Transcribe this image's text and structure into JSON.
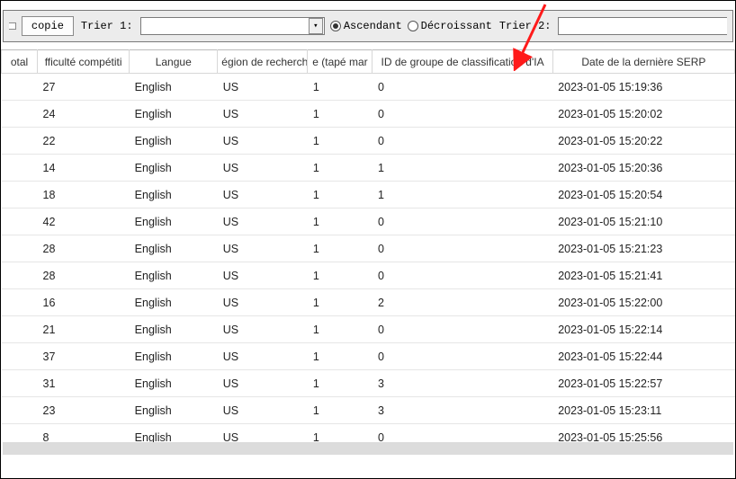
{
  "toolbar": {
    "copie_label": "copie",
    "trier1_label": "Trier 1:",
    "trier2_label": "Trier 2:",
    "trier1_value": "",
    "trier2_value": "",
    "ascendant_label": "Ascendant",
    "descroissant_label": "Décroissant",
    "sort_direction": "ascendant"
  },
  "columns": {
    "total": "otal",
    "difficulte": "fficulté compétiti",
    "langue": "Langue",
    "region": "égion de recherch",
    "tape": "e (tapé mar",
    "ai_group": "ID de groupe de classification d'IA",
    "date": "Date de la dernière SERP"
  },
  "rows": [
    {
      "total": "",
      "diff": "27",
      "lang": "English",
      "reg": "US",
      "tape": "1",
      "ai": "0",
      "date": "2023-01-05 15:19:36"
    },
    {
      "total": "",
      "diff": "24",
      "lang": "English",
      "reg": "US",
      "tape": "1",
      "ai": "0",
      "date": "2023-01-05 15:20:02"
    },
    {
      "total": "",
      "diff": "22",
      "lang": "English",
      "reg": "US",
      "tape": "1",
      "ai": "0",
      "date": "2023-01-05 15:20:22"
    },
    {
      "total": "",
      "diff": "14",
      "lang": "English",
      "reg": "US",
      "tape": "1",
      "ai": "1",
      "date": "2023-01-05 15:20:36"
    },
    {
      "total": "",
      "diff": "18",
      "lang": "English",
      "reg": "US",
      "tape": "1",
      "ai": "1",
      "date": "2023-01-05 15:20:54"
    },
    {
      "total": "",
      "diff": "42",
      "lang": "English",
      "reg": "US",
      "tape": "1",
      "ai": "0",
      "date": "2023-01-05 15:21:10"
    },
    {
      "total": "",
      "diff": "28",
      "lang": "English",
      "reg": "US",
      "tape": "1",
      "ai": "0",
      "date": "2023-01-05 15:21:23"
    },
    {
      "total": "",
      "diff": "28",
      "lang": "English",
      "reg": "US",
      "tape": "1",
      "ai": "0",
      "date": "2023-01-05 15:21:41"
    },
    {
      "total": "",
      "diff": "16",
      "lang": "English",
      "reg": "US",
      "tape": "1",
      "ai": "2",
      "date": "2023-01-05 15:22:00"
    },
    {
      "total": "",
      "diff": "21",
      "lang": "English",
      "reg": "US",
      "tape": "1",
      "ai": "0",
      "date": "2023-01-05 15:22:14"
    },
    {
      "total": "",
      "diff": "37",
      "lang": "English",
      "reg": "US",
      "tape": "1",
      "ai": "0",
      "date": "2023-01-05 15:22:44"
    },
    {
      "total": "",
      "diff": "31",
      "lang": "English",
      "reg": "US",
      "tape": "1",
      "ai": "3",
      "date": "2023-01-05 15:22:57"
    },
    {
      "total": "",
      "diff": "23",
      "lang": "English",
      "reg": "US",
      "tape": "1",
      "ai": "3",
      "date": "2023-01-05 15:23:11"
    },
    {
      "total": "",
      "diff": "8",
      "lang": "English",
      "reg": "US",
      "tape": "1",
      "ai": "0",
      "date": "2023-01-05 15:25:56"
    }
  ],
  "annotation": {
    "arrow_color": "#ff1a1a"
  }
}
